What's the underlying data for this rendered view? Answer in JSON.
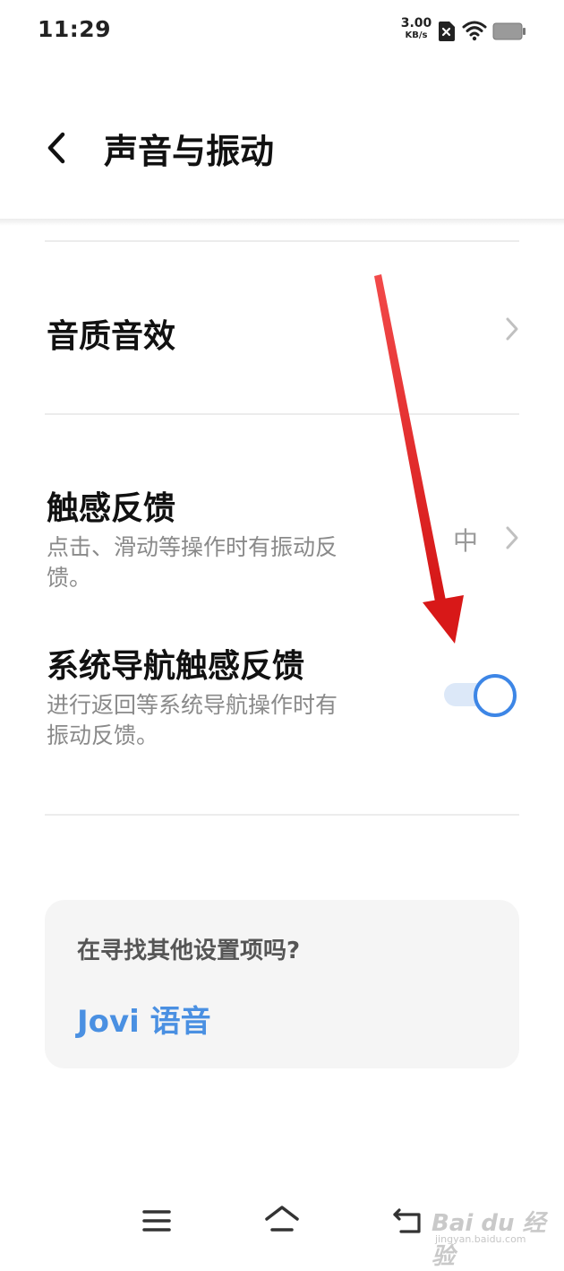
{
  "status_bar": {
    "time": "11:29",
    "net_speed_value": "3.00",
    "net_speed_unit": "KB/s",
    "icons": [
      "sim-off-icon",
      "wifi-icon",
      "battery-icon"
    ]
  },
  "header": {
    "back_icon": "chevron-left-icon",
    "title": "声音与振动"
  },
  "settings": {
    "sound_quality": {
      "title": "音质音效"
    },
    "haptic_feedback": {
      "title": "触感反馈",
      "subtitle_line1": "点击、滑动等操作时有振动反",
      "subtitle_line2": "馈。",
      "value": "中"
    },
    "nav_haptic": {
      "title": "系统导航触感反馈",
      "subtitle_line1": "进行返回等系统导航操作时有",
      "subtitle_line2": "振动反馈。",
      "enabled": true
    }
  },
  "search_card": {
    "question": "在寻找其他设置项吗?",
    "link": "Jovi 语音"
  },
  "nav_bar": {
    "icons": [
      "menu-icon",
      "home-icon",
      "back-icon"
    ]
  },
  "watermark": {
    "text": "Bai du 经验",
    "url": "jingyan.baidu.com"
  },
  "colors": {
    "accent": "#3d86e6",
    "link": "#4a90e2",
    "annotation_arrow": "#e02020"
  }
}
